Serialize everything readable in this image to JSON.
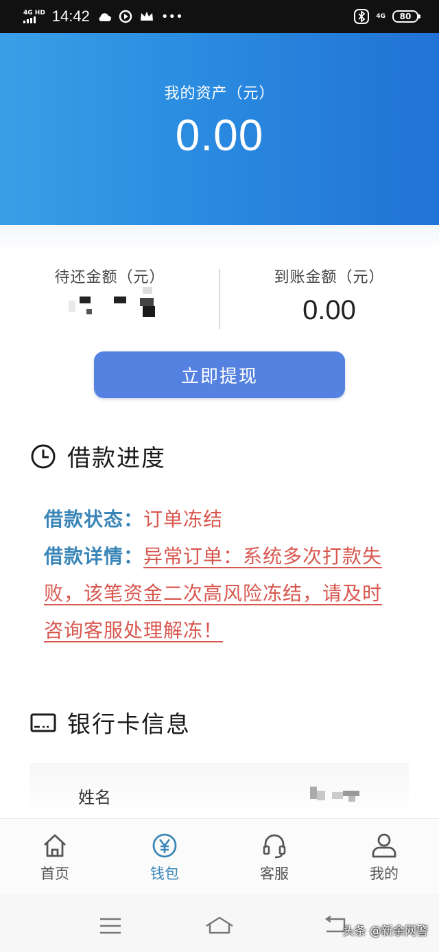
{
  "status_bar": {
    "network": "4G HD",
    "time": "14:42",
    "net_right": "4G",
    "battery": "80",
    "icons": [
      "cloud-icon",
      "play-icon",
      "crown-icon",
      "more-icon",
      "bluetooth-icon",
      "signal-icon",
      "battery-icon"
    ]
  },
  "hero": {
    "label": "我的资产（元）",
    "value": "0.00"
  },
  "amounts": {
    "pending_label": "待还金额（元）",
    "received_label": "到账金额（元）",
    "received_value": "0.00"
  },
  "withdraw_button": "立即提现",
  "loan_progress": {
    "title": "借款进度",
    "status_key": "借款状态：",
    "status_value": "订单冻结",
    "detail_key": "借款详情：",
    "detail_value": "异常订单：系统多次打款失败，该笔资金二次高风险冻结，请及时咨询客服处理解冻！"
  },
  "bank_card": {
    "title": "银行卡信息",
    "name_key": "姓名"
  },
  "tabs": [
    {
      "label": "首页",
      "icon": "home-icon"
    },
    {
      "label": "钱包",
      "icon": "yen-icon",
      "active": true
    },
    {
      "label": "客服",
      "icon": "headset-icon"
    },
    {
      "label": "我的",
      "icon": "user-icon"
    }
  ],
  "watermark": "头条 @新余网警",
  "colors": {
    "hero": "#2a8be0",
    "button": "#5582e0",
    "key_blue": "#3a86b8",
    "alert_red": "#d8574f"
  }
}
